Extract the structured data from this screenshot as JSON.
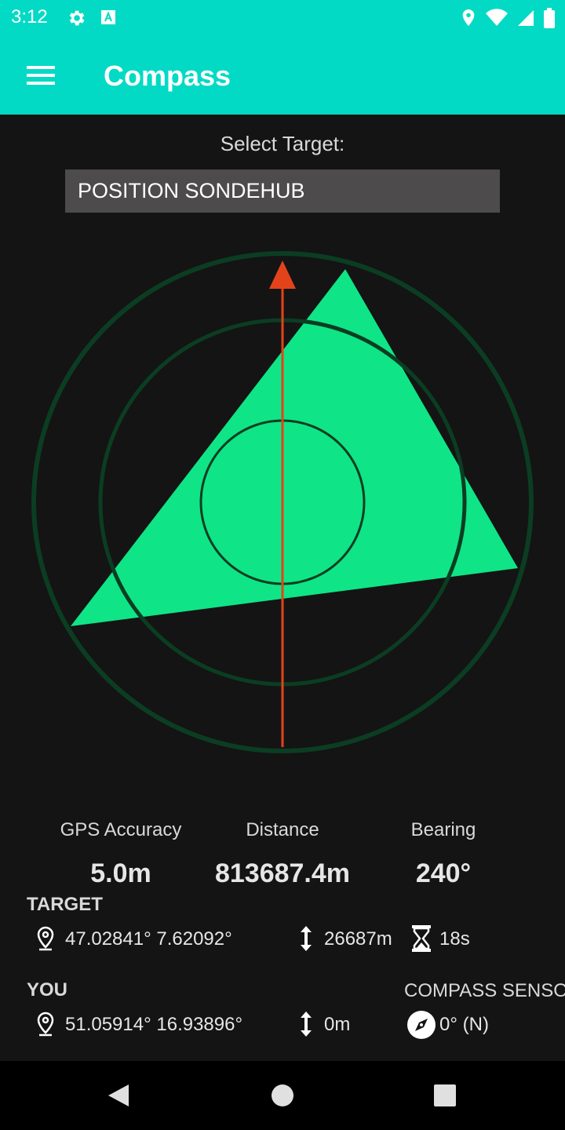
{
  "status_bar": {
    "time": "3:12",
    "left_icons": [
      "gear-icon",
      "font-a-icon"
    ],
    "right_icons": [
      "location-pin-icon",
      "wifi-icon",
      "signal-icon",
      "battery-icon"
    ]
  },
  "app_bar": {
    "title": "Compass",
    "color": "#03dac5"
  },
  "target_selector": {
    "label": "Select Target:",
    "selected": "POSITION SONDEHUB"
  },
  "compass": {
    "ring_color": "#0b3d22",
    "triangle_color": "#0fe586",
    "arrow_color": "#e3431b",
    "target_bearing_deg": 240
  },
  "stats": {
    "gps_accuracy": {
      "label": "GPS Accuracy",
      "value": "5.0m"
    },
    "distance": {
      "label": "Distance",
      "value": "813687.4m"
    },
    "bearing": {
      "label": "Bearing",
      "value": "240°"
    }
  },
  "target": {
    "title": "TARGET",
    "coords": "47.02841° 7.62092°",
    "altitude": "26687m",
    "age": "18s"
  },
  "you": {
    "title": "YOU",
    "coords": "51.05914° 16.93896°",
    "altitude": "0m"
  },
  "compass_sensor": {
    "title": "COMPASS SENSO",
    "value": "0° (N)"
  },
  "nav_bar": {
    "buttons": [
      "back-icon",
      "home-icon",
      "recents-icon"
    ]
  }
}
